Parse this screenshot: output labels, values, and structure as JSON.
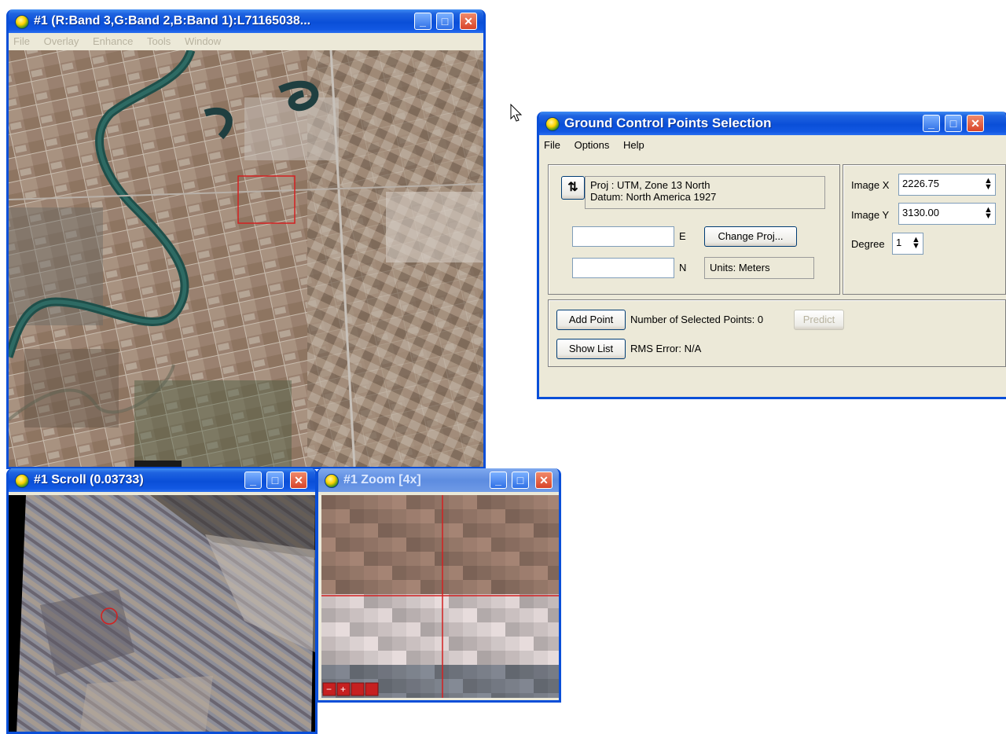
{
  "main_window": {
    "title": "#1 (R:Band 3,G:Band 2,B:Band 1):L71165038...",
    "menu": [
      "File",
      "Overlay",
      "Enhance",
      "Tools",
      "Window"
    ]
  },
  "scroll_window": {
    "title": "#1 Scroll (0.03733)"
  },
  "zoom_window": {
    "title": "#1 Zoom [4x]"
  },
  "gcp_dialog": {
    "title": "Ground Control Points Selection",
    "menu": [
      "File",
      "Options",
      "Help"
    ],
    "proj_line1": "Proj : UTM, Zone 13 North",
    "proj_line2": "Datum: North America 1927",
    "swap_icon_glyph": "⇅",
    "e_value": "",
    "e_label": "E",
    "n_value": "",
    "n_label": "N",
    "change_proj_label": "Change Proj...",
    "units_label": "Units: Meters",
    "image_x_label": "Image X",
    "image_x_value": "2226.75",
    "image_y_label": "Image Y",
    "image_y_value": "3130.00",
    "degree_label": "Degree",
    "degree_value": "1",
    "add_point_label": "Add Point",
    "selected_points_text": "Number of Selected Points: 0",
    "predict_label": "Predict",
    "show_list_label": "Show List",
    "rms_error_text": "RMS Error: N/A"
  },
  "colors": {
    "title_blue": "#0a4fd8",
    "window_face": "#ece9d8",
    "close_red": "#d8442a",
    "cursor_box_red": "#d42020"
  },
  "icons": {
    "app": "envi-globe-icon",
    "minimize": "minimize-icon",
    "maximize": "maximize-icon",
    "close": "close-icon",
    "spinner": "spinner-arrows-icon",
    "cursor": "mouse-pointer-icon"
  }
}
